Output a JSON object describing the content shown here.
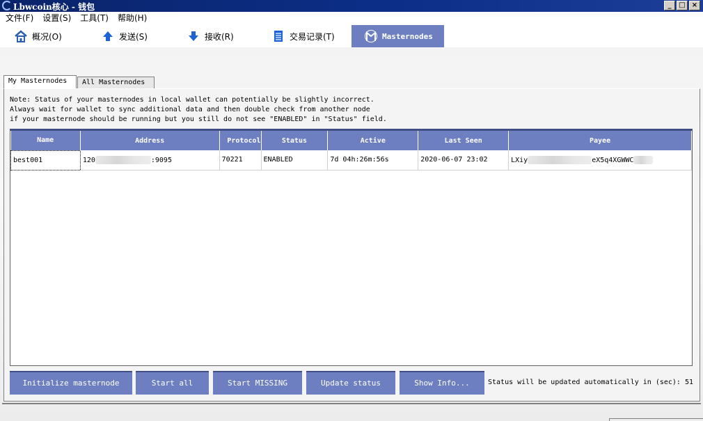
{
  "window": {
    "title": "Lbwcoin核心 - 钱包",
    "controls": [
      "minimize",
      "maximize",
      "close"
    ]
  },
  "menu": [
    "文件(F)",
    "设置(S)",
    "工具(T)",
    "帮助(H)"
  ],
  "toolbar": {
    "items": [
      {
        "label": "概况(O)",
        "icon": "home-icon"
      },
      {
        "label": "发送(S)",
        "icon": "arrow-up-icon"
      },
      {
        "label": "接收(R)",
        "icon": "arrow-down-icon"
      },
      {
        "label": "交易记录(T)",
        "icon": "list-icon"
      },
      {
        "label": "Masternodes",
        "icon": "masternode-icon"
      }
    ],
    "active": "Masternodes"
  },
  "tabs": [
    {
      "label": "My Masternodes",
      "selected": true
    },
    {
      "label": "All Masternodes",
      "selected": false
    }
  ],
  "note": {
    "line1": "Note: Status of your masternodes in local wallet can potentially be slightly incorrect.",
    "line2": "Always wait for wallet to sync additional data and then double check from another node",
    "line3": "if your masternode should be running but you still do not see \"ENABLED\" in \"Status\" field."
  },
  "table": {
    "headers": [
      "Name",
      "Address",
      "Protocol",
      "Status",
      "Active",
      "Last Seen",
      "Payee"
    ],
    "rows": [
      {
        "name": "best001",
        "address_start": "120",
        "address_end": ":9095",
        "protocol": "70221",
        "status": "ENABLED",
        "active": "7d 04h:26m:56s",
        "last_seen": "2020-06-07 23:02",
        "payee_start": "LXiy",
        "payee_end": "eX5q4XGWWC"
      }
    ]
  },
  "buttons": {
    "initialize": "Initialize masternode",
    "start_all": "Start all",
    "start_missing": "Start MISSING",
    "update_status": "Update status",
    "show_info": "Show Info..."
  },
  "status": {
    "label": "Status will be updated automatically in (sec):",
    "seconds": "51"
  },
  "colors": {
    "accent": "#6d7fc0",
    "titlebar": "#0a246a"
  }
}
